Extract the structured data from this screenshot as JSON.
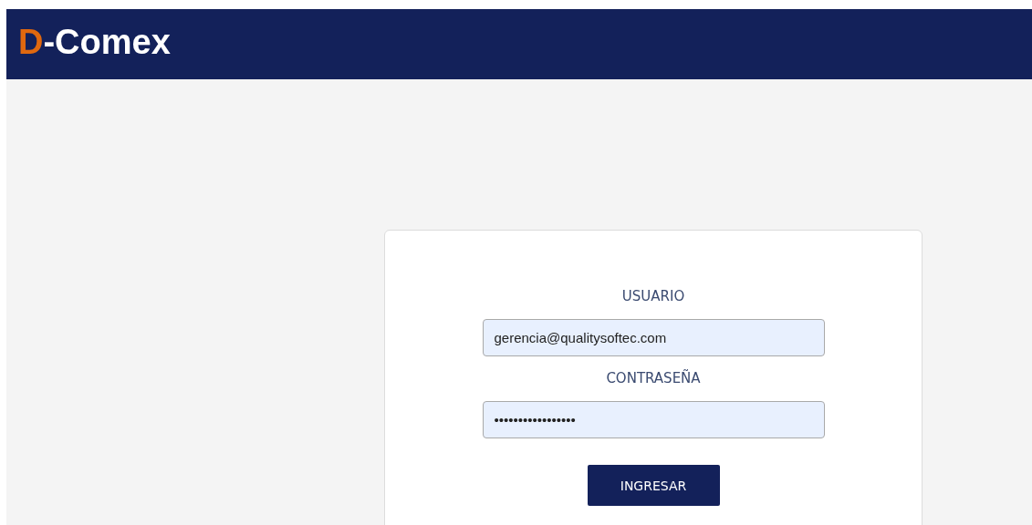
{
  "header": {
    "logo_mark": "D",
    "logo_text": "-Comex"
  },
  "login_form": {
    "fields": [
      {
        "label": "USUARIO",
        "value": "gerencia@qualitysoftec.com"
      },
      {
        "label": "CONTRASEÑA",
        "value": "•••••••••••••••••"
      }
    ],
    "submit_button": "INGRESAR"
  }
}
